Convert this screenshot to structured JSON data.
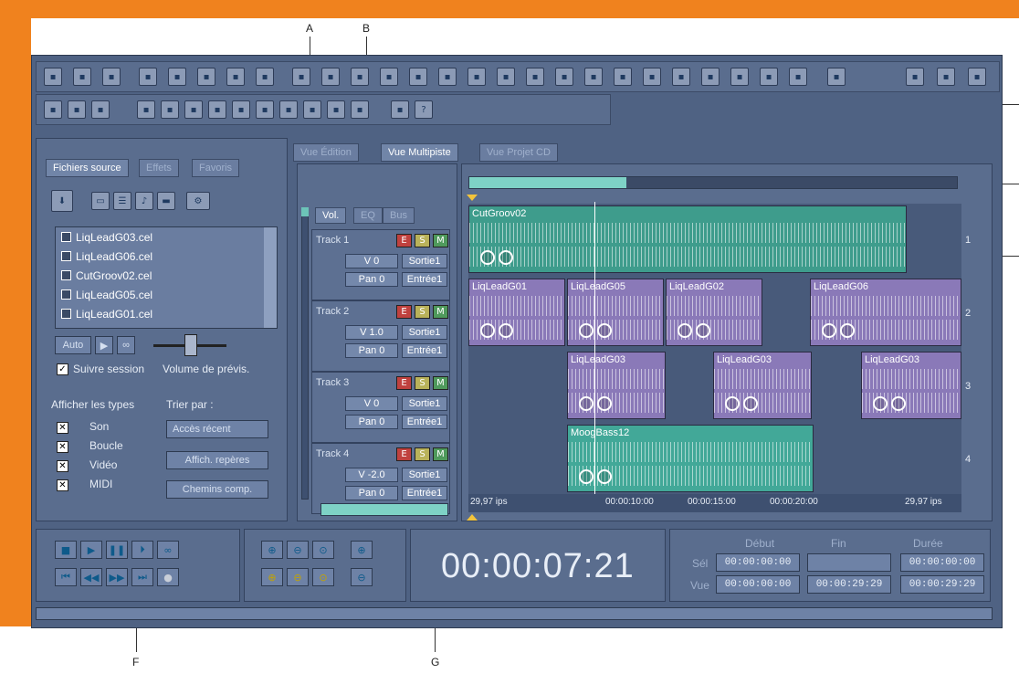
{
  "callouts": {
    "a": "A",
    "b": "B",
    "f": "F",
    "g": "G"
  },
  "colors": {
    "orange": "#f0821e",
    "app_bg": "#4f6283",
    "track1": "#3e9c8c",
    "track2": "#8a79b8",
    "track4": "#42a898"
  },
  "toolbar": {
    "icons": [
      "waveform-icon",
      "multitrack-icon",
      "cd-icon",
      "new-file-icon",
      "open-icon",
      "close-icon",
      "save-icon",
      "save-all-icon",
      "undo-icon",
      "cut-icon",
      "copy-icon",
      "paste-icon",
      "mix-paste-icon",
      "trim-icon",
      "silence-icon",
      "find-icon",
      "effects-icon",
      "envelope-icon",
      "eq-icon",
      "stretch-icon",
      "noise-icon",
      "pitch-icon",
      "loop-icon",
      "analysis-icon",
      "graphic-eq-icon",
      "wet-dry-icon",
      "fx-icon",
      "bpm-icon",
      "marker-icon",
      "cd-burn-icon"
    ],
    "row2_icons": [
      "time-select-icon",
      "hybrid-tool-icon",
      "move-copy-icon",
      "insert-track-icon",
      "delete-track-icon",
      "mixdown-icon",
      "lock-icon",
      "snap-icon",
      "play-loop-icon",
      "group-icon",
      "rewind-icon",
      "record-track-icon",
      "zoom-track-icon",
      "settings-icon",
      "help-icon"
    ]
  },
  "left_panel": {
    "tabs": [
      "Fichiers source",
      "Effets",
      "Favoris"
    ],
    "files": [
      "LiqLeadG03.cel",
      "LiqLeadG06.cel",
      "CutGroov02.cel",
      "LiqLeadG05.cel",
      "LiqLeadG01.cel"
    ],
    "auto_label": "Auto",
    "follow_session": "Suivre session",
    "volume_label": "Volume de prévis.",
    "show_types": "Afficher les types",
    "sort_by": "Trier par :",
    "sort_value": "Accès récent",
    "types": [
      "Son",
      "Boucle",
      "Vidéo",
      "MIDI"
    ],
    "show_markers": "Affich. repères",
    "paths": "Chemins comp."
  },
  "main_tabs": [
    "Vue Édition",
    "Vue Multipiste",
    "Vue Projet CD"
  ],
  "track_tabs": [
    "Vol.",
    "EQ",
    "Bus"
  ],
  "tracks": [
    {
      "name": "Track 1",
      "vol": "V 0",
      "pan": "Pan 0",
      "out": "Sortie1",
      "in": "Entrée1"
    },
    {
      "name": "Track 2",
      "vol": "V 1.0",
      "pan": "Pan 0",
      "out": "Sortie1",
      "in": "Entrée1"
    },
    {
      "name": "Track 3",
      "vol": "V 0",
      "pan": "Pan 0",
      "out": "Sortie1",
      "in": "Entrée1"
    },
    {
      "name": "Track 4",
      "vol": "V -2.0",
      "pan": "Pan 0",
      "out": "Sortie1",
      "in": "Entrée1"
    }
  ],
  "emb": {
    "e": "E",
    "s": "S",
    "m": "M"
  },
  "clips": {
    "t1": "CutGroov02",
    "t2": [
      "LiqLeadG01",
      "LiqLeadG05",
      "LiqLeadG02",
      "LiqLeadG06"
    ],
    "t3": [
      "LiqLeadG03",
      "LiqLeadG03",
      "LiqLeadG03"
    ],
    "t4": "MoogBass12"
  },
  "lane_numbers": [
    "1",
    "2",
    "3",
    "4"
  ],
  "ruler": {
    "left": "29,97 ips",
    "t1": "00:00:10:00",
    "t2": "00:00:15:00",
    "t3": "00:00:20:00",
    "right": "29,97 ips"
  },
  "time": {
    "display": "00:00:07:21",
    "head_start": "Début",
    "head_end": "Fin",
    "head_dur": "Durée",
    "row_sel": "Sél",
    "row_view": "Vue",
    "sel_start": "00:00:00:00",
    "sel_end": "",
    "sel_dur": "00:00:00:00",
    "view_start": "00:00:00:00",
    "view_end": "00:00:29:29",
    "view_dur": "00:00:29:29"
  }
}
